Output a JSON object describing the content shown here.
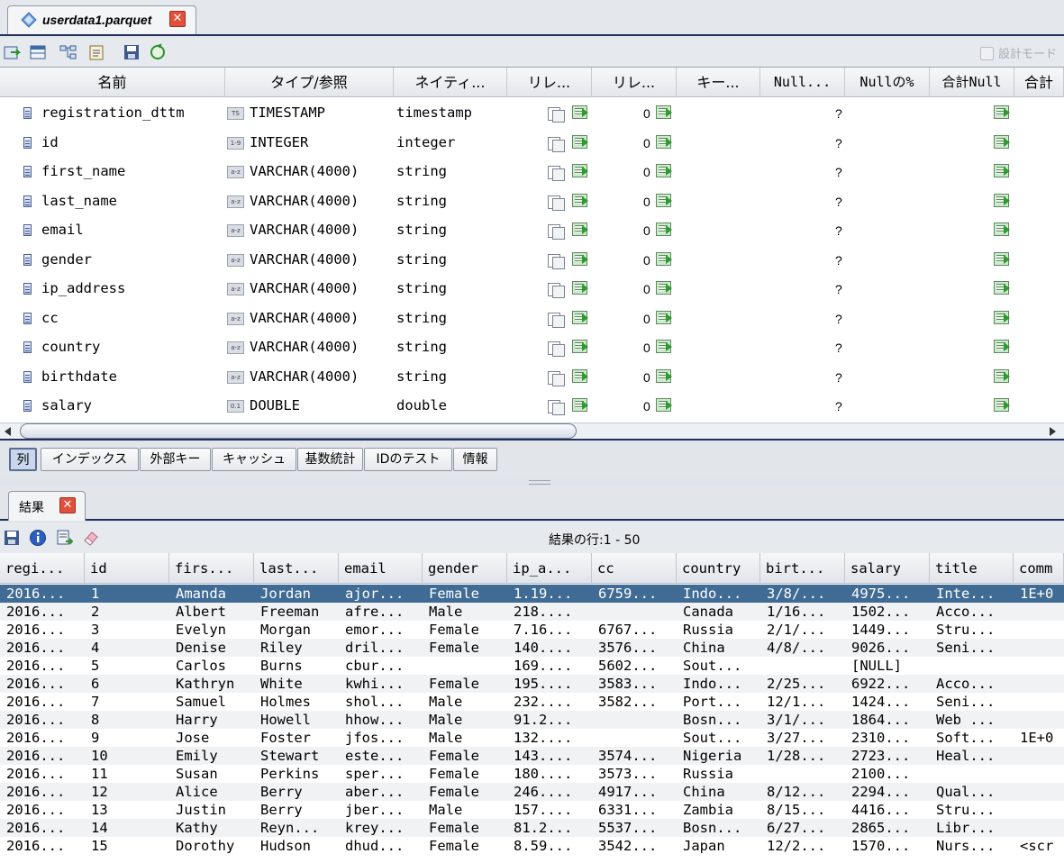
{
  "file_tab": {
    "title": "userdata1.parquet",
    "close": "✕"
  },
  "toolbar": {
    "design_mode_label": "設計モード"
  },
  "columns_grid": {
    "headers": [
      "名前",
      "タイプ/参照",
      "ネイティ...",
      "リレ...",
      "リレ...",
      "キー...",
      "Null...",
      "Nullの%",
      "合計Null",
      "合計"
    ],
    "rows": [
      {
        "name": "registration_dttm",
        "type_icon": "TS",
        "type": "TIMESTAMP",
        "native": "timestamp",
        "rel_count": "0",
        "null": "?"
      },
      {
        "name": "id",
        "type_icon": "1-9",
        "type": "INTEGER",
        "native": "integer",
        "rel_count": "0",
        "null": "?"
      },
      {
        "name": "first_name",
        "type_icon": "a-z",
        "type": "VARCHAR(4000)",
        "native": "string",
        "rel_count": "0",
        "null": "?"
      },
      {
        "name": "last_name",
        "type_icon": "a-z",
        "type": "VARCHAR(4000)",
        "native": "string",
        "rel_count": "0",
        "null": "?"
      },
      {
        "name": "email",
        "type_icon": "a-z",
        "type": "VARCHAR(4000)",
        "native": "string",
        "rel_count": "0",
        "null": "?"
      },
      {
        "name": "gender",
        "type_icon": "a-z",
        "type": "VARCHAR(4000)",
        "native": "string",
        "rel_count": "0",
        "null": "?"
      },
      {
        "name": "ip_address",
        "type_icon": "a-z",
        "type": "VARCHAR(4000)",
        "native": "string",
        "rel_count": "0",
        "null": "?"
      },
      {
        "name": "cc",
        "type_icon": "a-z",
        "type": "VARCHAR(4000)",
        "native": "string",
        "rel_count": "0",
        "null": "?"
      },
      {
        "name": "country",
        "type_icon": "a-z",
        "type": "VARCHAR(4000)",
        "native": "string",
        "rel_count": "0",
        "null": "?"
      },
      {
        "name": "birthdate",
        "type_icon": "a-z",
        "type": "VARCHAR(4000)",
        "native": "string",
        "rel_count": "0",
        "null": "?"
      },
      {
        "name": "salary",
        "type_icon": "0.1",
        "type": "DOUBLE",
        "native": "double",
        "rel_count": "0",
        "null": "?"
      }
    ]
  },
  "bottom_tabs": [
    "列",
    "インデックス",
    "外部キー",
    "キャッシュ",
    "基数統計",
    "IDのテスト",
    "情報"
  ],
  "results_tab": {
    "title": "結果",
    "close": "✕"
  },
  "results": {
    "row_count_label": "結果の行:1 - 50",
    "headers": [
      "regi...",
      "id",
      "firs...",
      "last...",
      "email",
      "gender",
      "ip_a...",
      "cc",
      "country",
      "birt...",
      "salary",
      "title",
      "comm"
    ],
    "rows": [
      [
        "2016...",
        "1",
        "Amanda",
        "Jordan",
        "ajor...",
        "Female",
        "1.19...",
        "6759...",
        "Indo...",
        "3/8/...",
        "4975...",
        "Inte...",
        "1E+0"
      ],
      [
        "2016...",
        "2",
        "Albert",
        "Freeman",
        "afre...",
        "Male",
        "218....",
        "",
        "Canada",
        "1/16...",
        "1502...",
        "Acco...",
        ""
      ],
      [
        "2016...",
        "3",
        "Evelyn",
        "Morgan",
        "emor...",
        "Female",
        "7.16...",
        "6767...",
        "Russia",
        "2/1/...",
        "1449...",
        "Stru...",
        ""
      ],
      [
        "2016...",
        "4",
        "Denise",
        "Riley",
        "dril...",
        "Female",
        "140....",
        "3576...",
        "China",
        "4/8/...",
        "9026...",
        "Seni...",
        ""
      ],
      [
        "2016...",
        "5",
        "Carlos",
        "Burns",
        "cbur...",
        "",
        "169....",
        "5602...",
        "Sout...",
        "",
        "[NULL]",
        "",
        ""
      ],
      [
        "2016...",
        "6",
        "Kathryn",
        "White",
        "kwhi...",
        "Female",
        "195....",
        "3583...",
        "Indo...",
        "2/25...",
        "6922...",
        "Acco...",
        ""
      ],
      [
        "2016...",
        "7",
        "Samuel",
        "Holmes",
        "shol...",
        "Male",
        "232....",
        "3582...",
        "Port...",
        "12/1...",
        "1424...",
        "Seni...",
        ""
      ],
      [
        "2016...",
        "8",
        "Harry",
        "Howell",
        "hhow...",
        "Male",
        "91.2...",
        "",
        "Bosn...",
        "3/1/...",
        "1864...",
        "Web ...",
        ""
      ],
      [
        "2016...",
        "9",
        "Jose",
        "Foster",
        "jfos...",
        "Male",
        "132....",
        "",
        "Sout...",
        "3/27...",
        "2310...",
        "Soft...",
        "1E+0"
      ],
      [
        "2016...",
        "10",
        "Emily",
        "Stewart",
        "este...",
        "Female",
        "143....",
        "3574...",
        "Nigeria",
        "1/28...",
        "2723...",
        "Heal...",
        ""
      ],
      [
        "2016...",
        "11",
        "Susan",
        "Perkins",
        "sper...",
        "Female",
        "180....",
        "3573...",
        "Russia",
        "",
        "2100...",
        "",
        ""
      ],
      [
        "2016...",
        "12",
        "Alice",
        "Berry",
        "aber...",
        "Female",
        "246....",
        "4917...",
        "China",
        "8/12...",
        "2294...",
        "Qual...",
        ""
      ],
      [
        "2016...",
        "13",
        "Justin",
        "Berry",
        "jber...",
        "Male",
        "157....",
        "6331...",
        "Zambia",
        "8/15...",
        "4416...",
        "Stru...",
        ""
      ],
      [
        "2016...",
        "14",
        "Kathy",
        "Reyn...",
        "krey...",
        "Female",
        "81.2...",
        "5537...",
        "Bosn...",
        "6/27...",
        "2865...",
        "Libr...",
        ""
      ],
      [
        "2016...",
        "15",
        "Dorothy",
        "Hudson",
        "dhud...",
        "Female",
        "8.59...",
        "3542...",
        "Japan",
        "12/2...",
        "1570...",
        "Nurs...",
        "<scr"
      ]
    ]
  },
  "colors": {
    "selected_row": "#3f6b95",
    "accent_border": "#22305a",
    "close_red": "#e0503a"
  }
}
